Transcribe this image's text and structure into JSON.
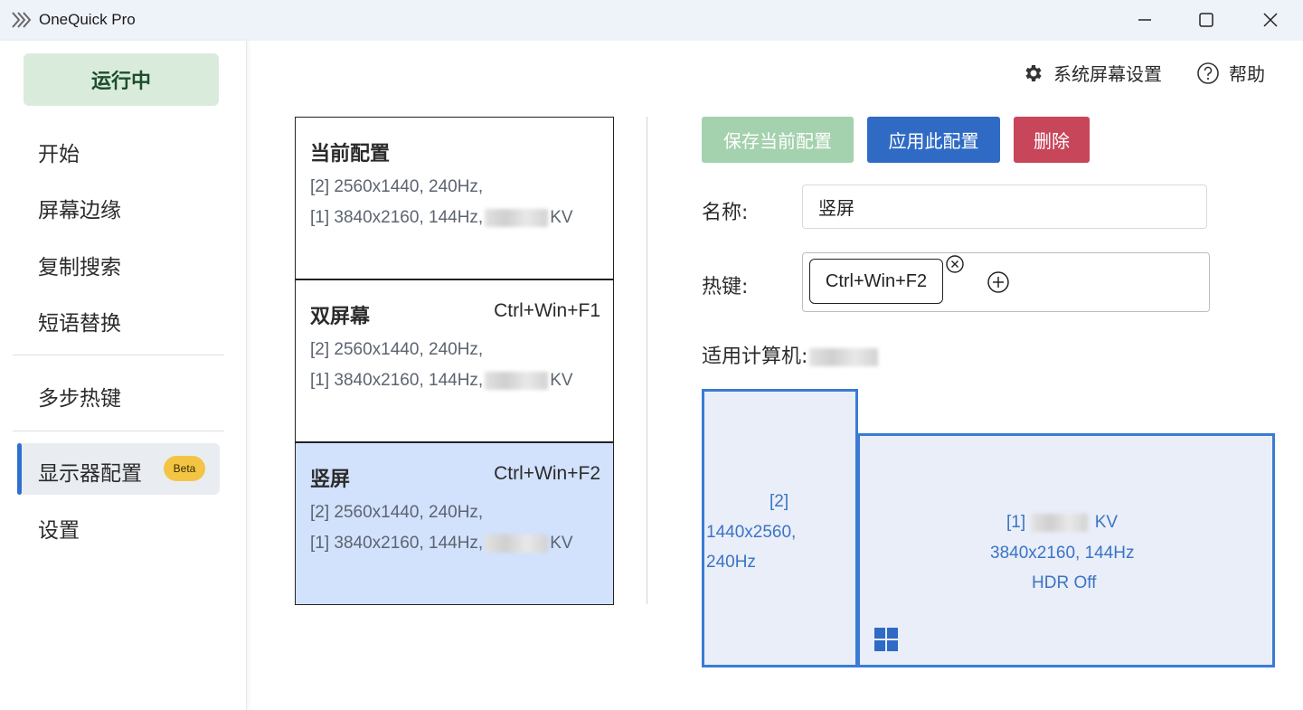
{
  "window": {
    "title": "OneQuick Pro",
    "controls": [
      "minimize-icon",
      "maximize-icon",
      "close-icon"
    ]
  },
  "sidebar": {
    "status": "运行中",
    "items": [
      {
        "label": "开始"
      },
      {
        "label": "屏幕边缘"
      },
      {
        "label": "复制搜索"
      },
      {
        "label": "短语替换"
      },
      {
        "label": "多步热键"
      },
      {
        "label": "显示器配置",
        "badge": "Beta",
        "active": true
      },
      {
        "label": "设置"
      }
    ]
  },
  "header": {
    "system_settings": "系统屏幕设置",
    "help": "帮助"
  },
  "configs": [
    {
      "name": "当前配置",
      "hotkey": "",
      "line1": "[2] 2560x1440, 240Hz,",
      "line2a": "[1] 3840x2160, 144Hz,",
      "line2b": "KV",
      "selected": false
    },
    {
      "name": "双屏幕",
      "hotkey": "Ctrl+Win+F1",
      "line1": "[2] 2560x1440, 240Hz,",
      "line2a": "[1] 3840x2160, 144Hz,",
      "line2b": "KV",
      "selected": false
    },
    {
      "name": "竖屏",
      "hotkey": "Ctrl+Win+F2",
      "line1": "[2] 2560x1440, 240Hz,",
      "line2a": "[1] 3840x2160, 144Hz,",
      "line2b": "KV",
      "selected": true
    }
  ],
  "actions": {
    "save": "保存当前配置",
    "apply": "应用此配置",
    "delete": "删除"
  },
  "form": {
    "name_label": "名称:",
    "name_value": "竖屏",
    "hotkey_label": "热键:",
    "hotkey_value": "Ctrl+Win+F2",
    "computer_label": "适用计算机:"
  },
  "monitors": {
    "m2": {
      "id": "[2]",
      "res": "1440x2560,",
      "rate": "240Hz"
    },
    "m1": {
      "id": "[1]",
      "model_suffix": "KV",
      "res": "3840x2160, 144Hz",
      "hdr": "HDR Off"
    }
  },
  "colors": {
    "accent": "#2f6bc4",
    "status_bg": "#d9ecdc",
    "selected_card": "#d2e2fc",
    "delete": "#c8465a",
    "save_disabled": "#a4d1ae",
    "badge": "#f4c544",
    "monitor_border": "#3a7bd5"
  }
}
